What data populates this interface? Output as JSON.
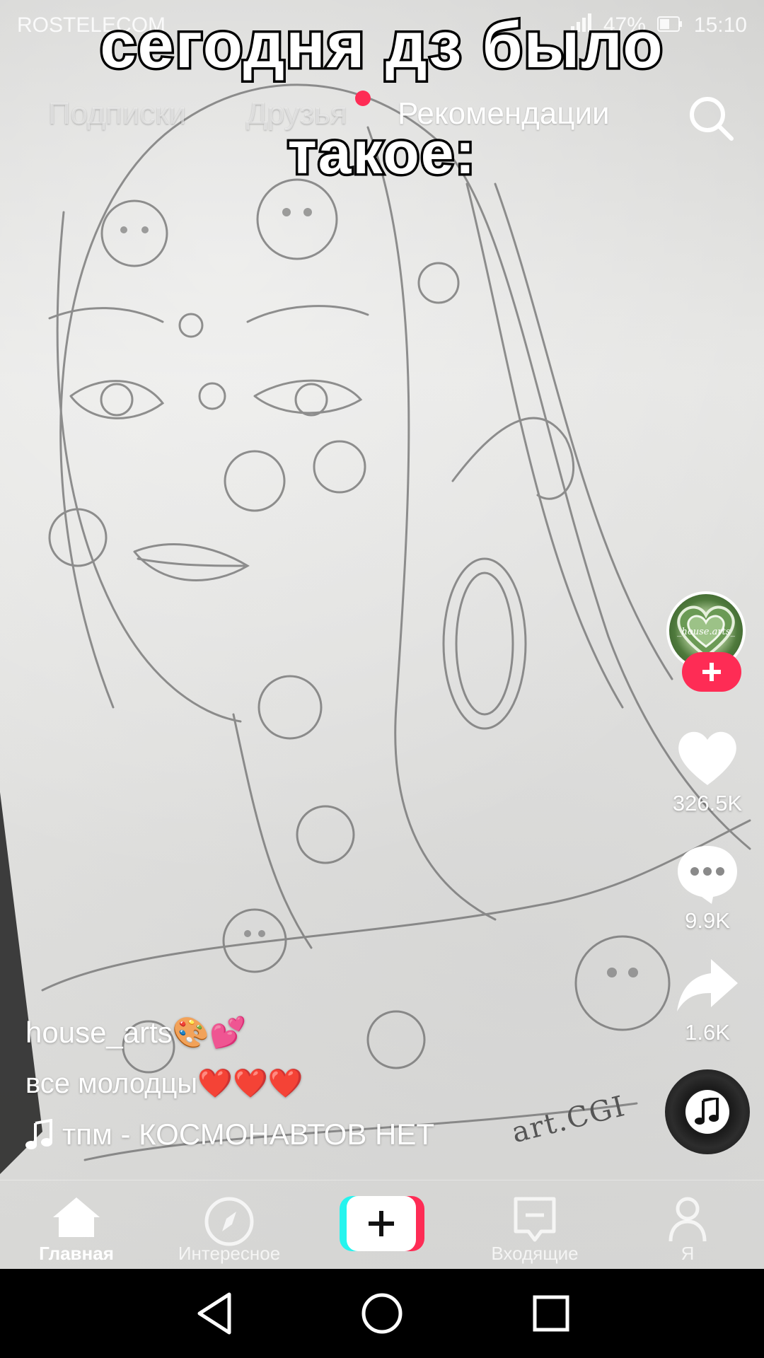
{
  "status_bar": {
    "carrier": "ROSTELECOM",
    "battery": "47%",
    "time": "15:10"
  },
  "caption": {
    "line1": "сегодня дз было",
    "line2": "такое:"
  },
  "top_tabs": {
    "following": "Подписки",
    "friends": "Друзья",
    "recommended": "Рекомендации",
    "active": "recommended"
  },
  "actions": {
    "likes": "326.5K",
    "comments": "9.9K",
    "shares": "1.6K"
  },
  "avatar_text": "_house.arts_",
  "watermark": "art.CGI",
  "video": {
    "username": "house_arts🎨💕",
    "description": "все молодцы❤️❤️❤️",
    "sound": "тпм - КОСМОНАВТОВ НЕТ"
  },
  "bottom_nav": {
    "home": "Главная",
    "discover": "Интересное",
    "inbox": "Входящие",
    "me": "Я"
  },
  "colors": {
    "accent_red": "#fe2c55",
    "accent_cyan": "#25f4ee"
  },
  "icons": [
    "search-icon",
    "heart-icon",
    "comment-icon",
    "share-icon",
    "music-note-icon",
    "home-icon",
    "compass-icon",
    "plus-icon",
    "inbox-icon",
    "profile-icon",
    "back-icon",
    "home-circle-icon",
    "recents-icon"
  ]
}
